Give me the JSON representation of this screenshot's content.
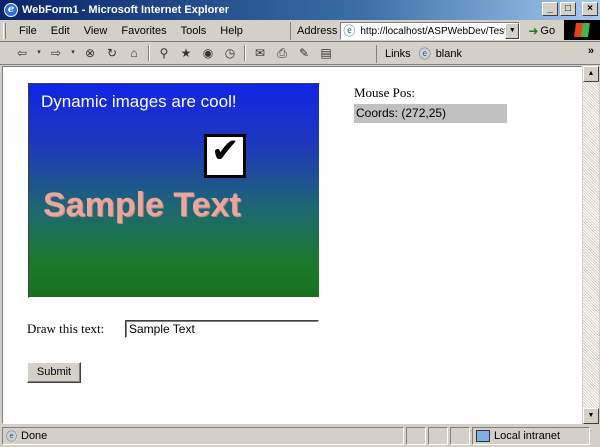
{
  "window": {
    "title": "WebForm1 - Microsoft Internet Explorer"
  },
  "menu": {
    "items": [
      "File",
      "Edit",
      "View",
      "Favorites",
      "Tools",
      "Help"
    ]
  },
  "address": {
    "label": "Address",
    "url": "http://localhost/ASPWebDev/TestN",
    "go_label": "Go"
  },
  "links": {
    "label": "Links",
    "blank_label": "blank",
    "more": "»"
  },
  "page": {
    "image_caption": "Dynamic images are cool!",
    "image_sample_text": "Sample Text",
    "mouse_pos_label": "Mouse Pos:",
    "coords_text": "Coords: (272,25)",
    "draw_label": "Draw this text:",
    "draw_value": "Sample Text",
    "submit_label": "Submit"
  },
  "status": {
    "text": "Done",
    "zone": "Local intranet"
  },
  "colors": {
    "titlebar": "#0a246a",
    "chrome": "#d4d0c8",
    "coords_bg": "#c0c0c0"
  }
}
